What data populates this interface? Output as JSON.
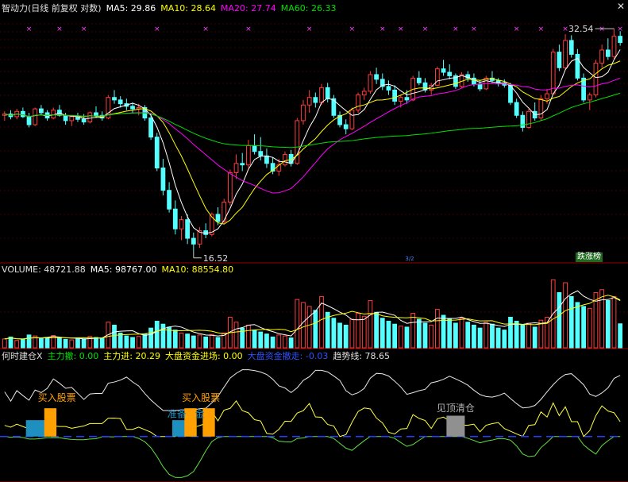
{
  "panes": {
    "main": {
      "indicator_name": "智动力(日线 前复权 对数)",
      "ma5_label": "MA5: 29.86",
      "ma10_label": "MA10: 28.64",
      "ma20_label": "MA20: 27.74",
      "ma60_label": "MA60: 26.33",
      "high_marker": "32.54",
      "low_marker": "16.52",
      "badge": "跌涨榜",
      "mini_tag": "3/2"
    },
    "volume": {
      "label": "VOLUME: 48721.88",
      "ma5_label": "MA5: 98767.00",
      "ma10_label": "MA10: 88554.80"
    },
    "signal": {
      "name": "何时建仓X",
      "main_flag": "主力撤: 0.00",
      "main_in": "主力进: 20.29",
      "market_in": "大盘资金进场: 0.00",
      "market_out": "大盘资金撤走: -0.03",
      "trend_line": "趋势线: 78.65",
      "buy_label_1": "买入股票",
      "buy_label_2": "买入股票",
      "prepare_label": "准备",
      "fund_label": "金",
      "top_clear_label": "见顶清仓"
    }
  },
  "colors": {
    "up": "#ff3c3c",
    "down": "#54ffff",
    "ma5": "#ffffff",
    "ma10": "#ffff00",
    "ma20": "#ff00ff",
    "ma60": "#00e000",
    "grid": "#9a0000",
    "buy_bar": "#ffa000",
    "prepare_bar": "#1e90c0",
    "top_bar": "#909090"
  },
  "chart_data": {
    "type": "candlestick",
    "ohlc": [
      [
        25.0,
        25.3,
        24.6,
        25.1
      ],
      [
        25.1,
        25.4,
        24.7,
        24.9
      ],
      [
        24.9,
        25.5,
        24.7,
        25.3
      ],
      [
        25.3,
        25.6,
        24.8,
        24.9
      ],
      [
        24.9,
        25.2,
        24.1,
        24.3
      ],
      [
        24.3,
        25.6,
        24.2,
        25.5
      ],
      [
        25.5,
        25.8,
        25.0,
        25.2
      ],
      [
        25.2,
        25.4,
        24.6,
        24.8
      ],
      [
        24.8,
        25.6,
        24.7,
        25.4
      ],
      [
        25.4,
        25.8,
        24.9,
        25.0
      ],
      [
        25.0,
        25.2,
        24.3,
        24.6
      ],
      [
        24.6,
        25.0,
        24.2,
        24.9
      ],
      [
        24.9,
        25.2,
        24.5,
        24.7
      ],
      [
        24.7,
        25.1,
        24.3,
        24.5
      ],
      [
        24.5,
        25.3,
        24.4,
        25.2
      ],
      [
        25.2,
        25.7,
        24.8,
        25.0
      ],
      [
        25.0,
        25.3,
        24.6,
        24.8
      ],
      [
        24.8,
        26.6,
        24.7,
        26.4
      ],
      [
        26.4,
        27.0,
        25.9,
        26.2
      ],
      [
        26.2,
        26.5,
        25.6,
        25.9
      ],
      [
        25.9,
        26.3,
        25.4,
        25.7
      ],
      [
        25.7,
        26.0,
        25.2,
        25.5
      ],
      [
        25.5,
        25.9,
        25.0,
        25.6
      ],
      [
        25.6,
        25.8,
        24.6,
        24.8
      ],
      [
        24.8,
        25.1,
        23.2,
        23.4
      ],
      [
        23.4,
        23.7,
        21.1,
        21.3
      ],
      [
        21.3,
        21.9,
        19.6,
        19.9
      ],
      [
        19.9,
        20.4,
        18.6,
        18.8
      ],
      [
        18.8,
        19.3,
        17.4,
        17.7
      ],
      [
        17.7,
        18.4,
        17.1,
        18.2
      ],
      [
        18.2,
        18.5,
        16.9,
        17.2
      ],
      [
        17.2,
        17.5,
        16.52,
        16.9
      ],
      [
        16.9,
        17.8,
        16.7,
        17.6
      ],
      [
        17.6,
        18.0,
        17.2,
        17.4
      ],
      [
        17.4,
        18.6,
        17.3,
        18.5
      ],
      [
        18.5,
        18.9,
        17.9,
        18.1
      ],
      [
        18.1,
        19.4,
        18.0,
        19.2
      ],
      [
        19.2,
        21.2,
        19.0,
        21.0
      ],
      [
        21.0,
        22.2,
        20.6,
        21.6
      ],
      [
        21.6,
        22.3,
        21.1,
        21.5
      ],
      [
        21.5,
        23.2,
        21.3,
        22.8
      ],
      [
        22.8,
        23.6,
        22.2,
        22.4
      ],
      [
        22.4,
        23.4,
        21.8,
        22.1
      ],
      [
        22.1,
        22.6,
        21.3,
        21.6
      ],
      [
        21.6,
        22.0,
        20.9,
        21.1
      ],
      [
        21.1,
        21.9,
        20.8,
        21.5
      ],
      [
        21.5,
        22.4,
        21.4,
        22.2
      ],
      [
        22.2,
        22.5,
        21.4,
        21.6
      ],
      [
        21.6,
        24.8,
        21.5,
        24.6
      ],
      [
        24.6,
        26.2,
        24.3,
        25.8
      ],
      [
        25.8,
        27.0,
        25.2,
        26.4
      ],
      [
        26.4,
        26.8,
        25.6,
        26.0
      ],
      [
        26.0,
        27.5,
        25.8,
        27.2
      ],
      [
        27.2,
        27.6,
        26.0,
        26.3
      ],
      [
        26.3,
        26.6,
        24.8,
        25.0
      ],
      [
        25.0,
        25.3,
        24.1,
        24.3
      ],
      [
        24.3,
        24.7,
        23.6,
        24.0
      ],
      [
        24.0,
        25.6,
        23.9,
        25.4
      ],
      [
        25.4,
        26.8,
        25.2,
        26.6
      ],
      [
        26.6,
        27.2,
        26.2,
        26.9
      ],
      [
        26.9,
        28.6,
        26.7,
        28.3
      ],
      [
        28.3,
        28.9,
        27.5,
        27.9
      ],
      [
        27.9,
        28.4,
        27.0,
        27.3
      ],
      [
        27.3,
        27.8,
        26.6,
        27.0
      ],
      [
        27.0,
        27.4,
        25.8,
        26.1
      ],
      [
        26.1,
        26.6,
        25.6,
        26.4
      ],
      [
        26.4,
        27.0,
        25.9,
        26.2
      ],
      [
        26.2,
        28.2,
        26.1,
        28.0
      ],
      [
        28.0,
        28.6,
        27.4,
        27.6
      ],
      [
        27.6,
        28.0,
        26.8,
        27.0
      ],
      [
        27.0,
        27.6,
        26.6,
        27.4
      ],
      [
        27.4,
        29.0,
        27.3,
        28.8
      ],
      [
        28.8,
        29.6,
        28.2,
        28.5
      ],
      [
        28.5,
        29.2,
        27.9,
        28.2
      ],
      [
        28.2,
        28.4,
        27.1,
        27.3
      ],
      [
        27.3,
        28.5,
        27.2,
        28.3
      ],
      [
        28.3,
        28.6,
        27.7,
        28.0
      ],
      [
        28.0,
        28.4,
        27.3,
        27.5
      ],
      [
        27.5,
        27.8,
        26.9,
        27.1
      ],
      [
        27.1,
        28.2,
        27.0,
        28.0
      ],
      [
        28.0,
        28.6,
        27.6,
        27.8
      ],
      [
        27.8,
        28.0,
        27.3,
        27.6
      ],
      [
        27.6,
        27.9,
        27.2,
        27.4
      ],
      [
        27.4,
        27.6,
        25.8,
        26.0
      ],
      [
        26.0,
        26.3,
        24.8,
        25.0
      ],
      [
        25.0,
        25.3,
        23.8,
        24.1
      ],
      [
        24.1,
        25.5,
        24.0,
        25.3
      ],
      [
        25.3,
        26.0,
        24.6,
        24.8
      ],
      [
        24.8,
        26.6,
        24.6,
        26.3
      ],
      [
        26.3,
        27.1,
        25.9,
        26.7
      ],
      [
        26.7,
        30.6,
        26.6,
        30.3
      ],
      [
        30.3,
        31.0,
        28.6,
        28.9
      ],
      [
        28.9,
        32.0,
        28.7,
        31.4
      ],
      [
        31.4,
        31.9,
        29.8,
        30.1
      ],
      [
        30.1,
        30.6,
        27.8,
        28.0
      ],
      [
        28.0,
        28.4,
        26.0,
        26.2
      ],
      [
        26.2,
        26.8,
        25.4,
        26.6
      ],
      [
        26.6,
        29.6,
        26.4,
        29.3
      ],
      [
        29.3,
        31.0,
        28.9,
        30.5
      ],
      [
        30.5,
        31.6,
        29.6,
        29.9
      ],
      [
        29.9,
        32.54,
        29.7,
        31.8
      ],
      [
        31.8,
        32.3,
        30.9,
        31.2
      ]
    ],
    "price_range": [
      16.0,
      34.0
    ],
    "high_label_value": 32.54,
    "low_label_value": 16.52,
    "volume": [
      18000,
      22000,
      15000,
      17000,
      26000,
      24000,
      19000,
      21000,
      25000,
      20000,
      17000,
      16000,
      19000,
      18000,
      23000,
      21000,
      19000,
      52000,
      46000,
      30000,
      24000,
      21000,
      23000,
      28000,
      40000,
      54000,
      48000,
      42000,
      36000,
      30000,
      28000,
      24000,
      26000,
      22000,
      27000,
      21000,
      30000,
      62000,
      52000,
      40000,
      46000,
      36000,
      32000,
      28000,
      22000,
      26000,
      24000,
      20000,
      98000,
      92000,
      84000,
      76000,
      104000,
      72000,
      60000,
      50000,
      46000,
      58000,
      70000,
      64000,
      96000,
      72000,
      60000,
      54000,
      48000,
      44000,
      42000,
      70000,
      58000,
      50000,
      46000,
      78000,
      66000,
      58000,
      50000,
      60000,
      52000,
      46000,
      40000,
      52000,
      48000,
      40000,
      36000,
      62000,
      54000,
      46000,
      50000,
      42000,
      56000,
      62000,
      138000,
      112000,
      132000,
      104000,
      92000,
      84000,
      80000,
      112000,
      118000,
      96000,
      104000,
      48721.88
    ],
    "volume_range": [
      0,
      145000
    ],
    "signal_range": [
      -60,
      100
    ]
  }
}
